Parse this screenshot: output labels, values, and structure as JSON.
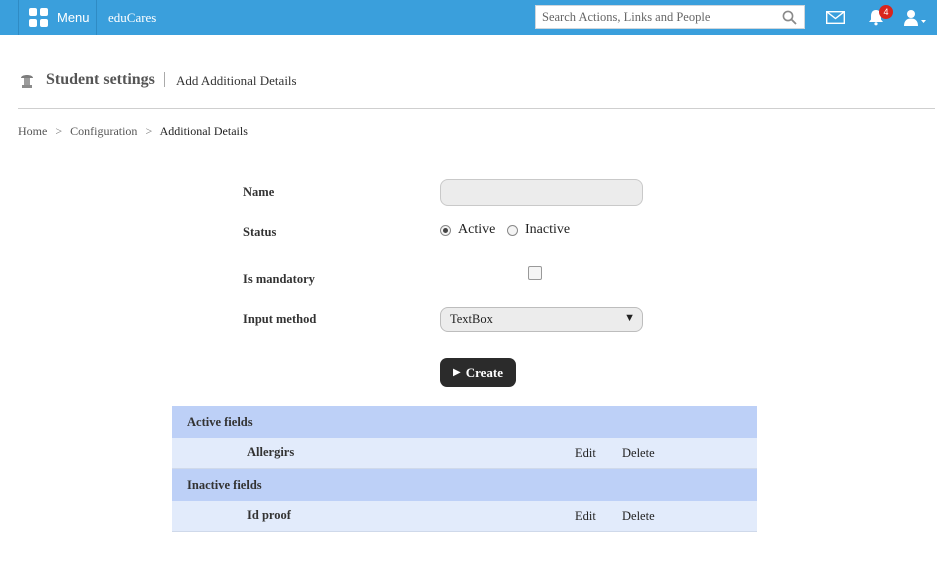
{
  "topbar": {
    "menu_label": "Menu",
    "brand": "eduCares",
    "search_placeholder": "Search Actions, Links and People",
    "notification_count": "4",
    "icons": [
      "grid-icon",
      "search-icon",
      "mail-icon",
      "bell-icon",
      "user-icon"
    ]
  },
  "page": {
    "title": "Student settings",
    "subtitle": "Add Additional Details"
  },
  "breadcrumb": {
    "items": [
      "Home",
      "Configuration",
      "Additional Details"
    ],
    "separator": ">"
  },
  "form": {
    "name_label": "Name",
    "name_value": "",
    "status_label": "Status",
    "status_options": [
      "Active",
      "Inactive"
    ],
    "status_selected": "Active",
    "mandatory_label": "Is mandatory",
    "mandatory_checked": false,
    "input_method_label": "Input method",
    "input_method_value": "TextBox",
    "create_label": "Create"
  },
  "fields": {
    "active_title": "Active fields",
    "active": [
      {
        "name": "Allergirs",
        "edit": "Edit",
        "delete": "Delete"
      }
    ],
    "inactive_title": "Inactive fields",
    "inactive": [
      {
        "name": "Id proof",
        "edit": "Edit",
        "delete": "Delete"
      }
    ]
  },
  "colors": {
    "topbar": "#3a9fdc",
    "group_header": "#bdd0f7",
    "row": "#e2ebfb",
    "badge": "#d9251d"
  }
}
